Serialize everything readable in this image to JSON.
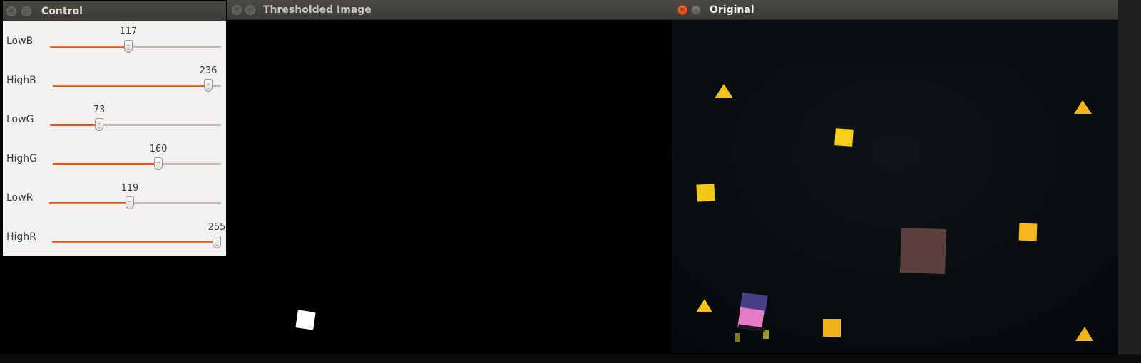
{
  "windows": {
    "control": {
      "title": "Control",
      "close_glyph": "×",
      "minimize_glyph": "–",
      "sliders": [
        {
          "label": "LowB",
          "value": "117",
          "fraction": 0.459
        },
        {
          "label": "HighB",
          "value": "236",
          "fraction": 0.925
        },
        {
          "label": "LowG",
          "value": "73",
          "fraction": 0.286
        },
        {
          "label": "HighG",
          "value": "160",
          "fraction": 0.627
        },
        {
          "label": "LowR",
          "value": "119",
          "fraction": 0.467
        },
        {
          "label": "HighR",
          "value": "255",
          "fraction": 1.0
        }
      ]
    },
    "thresholded": {
      "title": "Thresholded Image",
      "close_glyph": "×",
      "minimize_glyph": "–"
    },
    "original": {
      "title": "Original",
      "close_glyph": "×",
      "minimize_glyph": "–"
    }
  },
  "colors": {
    "slider_fill": "#f07746",
    "marker_yellow": "#f2c21c",
    "marker_orange": "#f3b51c",
    "brown_square": "#5a3f3c",
    "robot_pink": "#e57ac6",
    "robot_purple": "#4a3f86"
  },
  "icons": {
    "close": "close-icon",
    "minimize": "minimize-icon"
  }
}
